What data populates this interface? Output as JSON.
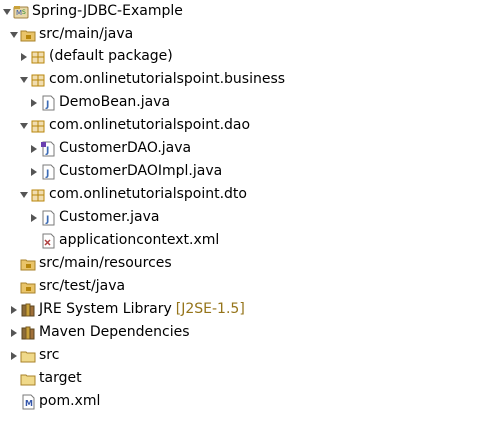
{
  "project_explorer": {
    "project": {
      "name": "Spring-JDBC-Example"
    },
    "src_main_java": {
      "label": "src/main/java"
    },
    "default_package": {
      "label": "(default package)"
    },
    "pkg_business": {
      "label": "com.onlinetutorialspoint.business"
    },
    "file_demobean": {
      "label": "DemoBean.java"
    },
    "pkg_dao": {
      "label": "com.onlinetutorialspoint.dao"
    },
    "file_customerdao": {
      "label": "CustomerDAO.java"
    },
    "file_customerdaoimpl": {
      "label": "CustomerDAOImpl.java"
    },
    "pkg_dto": {
      "label": "com.onlinetutorialspoint.dto"
    },
    "file_customer": {
      "label": "Customer.java"
    },
    "file_appcontext": {
      "label": "applicationcontext.xml"
    },
    "src_main_resources": {
      "label": "src/main/resources"
    },
    "src_test_java": {
      "label": "src/test/java"
    },
    "jre_library": {
      "label": "JRE System Library",
      "decoration": "[J2SE-1.5]"
    },
    "maven_dependencies": {
      "label": "Maven Dependencies"
    },
    "folder_src": {
      "label": "src"
    },
    "folder_target": {
      "label": "target"
    },
    "file_pom": {
      "label": "pom.xml"
    }
  },
  "colors": {
    "text": "#000000",
    "decoration": "#95741a",
    "arrow": "#555555",
    "package": "#b8860b",
    "folder": "#c9a13a",
    "java_file_accent": "#3b6bb5",
    "interface_accent": "#6a3fb0",
    "xml_accent": "#b04040"
  }
}
